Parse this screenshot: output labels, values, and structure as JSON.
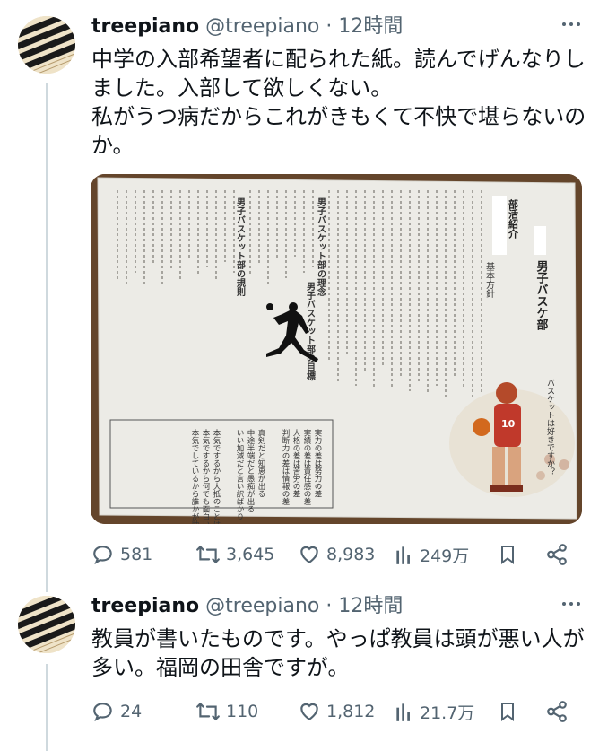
{
  "tweets": [
    {
      "display_name": "treepiano",
      "handle": "@treepiano",
      "separator": " · ",
      "time": "12時間",
      "text": "中学の入部希望者に配られた紙。読んでげんなりしました。入部して欲しくない。\n私がうつ病だからこれがきもくて不快で堪らないのか。",
      "stats": {
        "replies": "581",
        "retweets": "3,645",
        "likes": "8,983",
        "views": "249万"
      },
      "media": {
        "heading": "男子バスケ部",
        "section": "部活紹介",
        "basic_policy": "基本方針",
        "player_caption": "バスケットは好きですか？",
        "rules_title": "男子バスケット部の規則",
        "philosophy_title": "男子バスケット部の理念",
        "goals_title": "男子バスケット部の目標",
        "box_lines": [
          "実力の差は努力の差",
          "実績の差は責任感の差",
          "人格の差は苦労の差",
          "判断力の差は情報の差",
          "真剣だと知恵が出る",
          "中途半端だと愚痴が出る",
          "いい加減だと言い訳ばかり",
          "本気でするから大抵のことはできる",
          "本気でするから何でも面白い",
          "本気でしているから誰かが助けてくれる"
        ]
      }
    },
    {
      "display_name": "treepiano",
      "handle": "@treepiano",
      "separator": " · ",
      "time": "12時間",
      "text": "教員が書いたものです。やっぱ教員は頭が悪い人が多い。福岡の田舎ですが。",
      "stats": {
        "replies": "24",
        "retweets": "110",
        "likes": "1,812",
        "views": "21.7万"
      }
    }
  ],
  "icons": [
    "more-icon",
    "reply-icon",
    "retweet-icon",
    "like-icon",
    "views-icon",
    "bookmark-icon",
    "share-icon"
  ],
  "colors": {
    "text": "#0f1419",
    "secondary": "#536471",
    "thread_line": "#cfd9de"
  }
}
